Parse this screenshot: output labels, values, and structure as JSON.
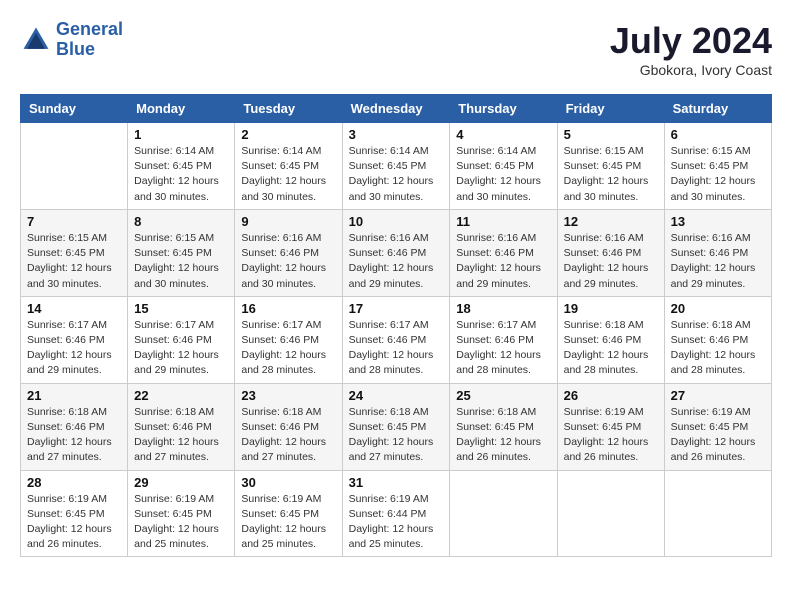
{
  "header": {
    "logo_line1": "General",
    "logo_line2": "Blue",
    "main_title": "July 2024",
    "subtitle": "Gbokora, Ivory Coast"
  },
  "days_header": [
    "Sunday",
    "Monday",
    "Tuesday",
    "Wednesday",
    "Thursday",
    "Friday",
    "Saturday"
  ],
  "weeks": [
    [
      {
        "num": "",
        "info": ""
      },
      {
        "num": "1",
        "info": "Sunrise: 6:14 AM\nSunset: 6:45 PM\nDaylight: 12 hours\nand 30 minutes."
      },
      {
        "num": "2",
        "info": "Sunrise: 6:14 AM\nSunset: 6:45 PM\nDaylight: 12 hours\nand 30 minutes."
      },
      {
        "num": "3",
        "info": "Sunrise: 6:14 AM\nSunset: 6:45 PM\nDaylight: 12 hours\nand 30 minutes."
      },
      {
        "num": "4",
        "info": "Sunrise: 6:14 AM\nSunset: 6:45 PM\nDaylight: 12 hours\nand 30 minutes."
      },
      {
        "num": "5",
        "info": "Sunrise: 6:15 AM\nSunset: 6:45 PM\nDaylight: 12 hours\nand 30 minutes."
      },
      {
        "num": "6",
        "info": "Sunrise: 6:15 AM\nSunset: 6:45 PM\nDaylight: 12 hours\nand 30 minutes."
      }
    ],
    [
      {
        "num": "7",
        "info": ""
      },
      {
        "num": "8",
        "info": "Sunrise: 6:15 AM\nSunset: 6:45 PM\nDaylight: 12 hours\nand 30 minutes."
      },
      {
        "num": "9",
        "info": "Sunrise: 6:16 AM\nSunset: 6:46 PM\nDaylight: 12 hours\nand 30 minutes."
      },
      {
        "num": "10",
        "info": "Sunrise: 6:16 AM\nSunset: 6:46 PM\nDaylight: 12 hours\nand 29 minutes."
      },
      {
        "num": "11",
        "info": "Sunrise: 6:16 AM\nSunset: 6:46 PM\nDaylight: 12 hours\nand 29 minutes."
      },
      {
        "num": "12",
        "info": "Sunrise: 6:16 AM\nSunset: 6:46 PM\nDaylight: 12 hours\nand 29 minutes."
      },
      {
        "num": "13",
        "info": "Sunrise: 6:16 AM\nSunset: 6:46 PM\nDaylight: 12 hours\nand 29 minutes."
      }
    ],
    [
      {
        "num": "14",
        "info": ""
      },
      {
        "num": "15",
        "info": "Sunrise: 6:17 AM\nSunset: 6:46 PM\nDaylight: 12 hours\nand 29 minutes."
      },
      {
        "num": "16",
        "info": "Sunrise: 6:17 AM\nSunset: 6:46 PM\nDaylight: 12 hours\nand 28 minutes."
      },
      {
        "num": "17",
        "info": "Sunrise: 6:17 AM\nSunset: 6:46 PM\nDaylight: 12 hours\nand 28 minutes."
      },
      {
        "num": "18",
        "info": "Sunrise: 6:17 AM\nSunset: 6:46 PM\nDaylight: 12 hours\nand 28 minutes."
      },
      {
        "num": "19",
        "info": "Sunrise: 6:18 AM\nSunset: 6:46 PM\nDaylight: 12 hours\nand 28 minutes."
      },
      {
        "num": "20",
        "info": "Sunrise: 6:18 AM\nSunset: 6:46 PM\nDaylight: 12 hours\nand 28 minutes."
      }
    ],
    [
      {
        "num": "21",
        "info": ""
      },
      {
        "num": "22",
        "info": "Sunrise: 6:18 AM\nSunset: 6:46 PM\nDaylight: 12 hours\nand 27 minutes."
      },
      {
        "num": "23",
        "info": "Sunrise: 6:18 AM\nSunset: 6:46 PM\nDaylight: 12 hours\nand 27 minutes."
      },
      {
        "num": "24",
        "info": "Sunrise: 6:18 AM\nSunset: 6:45 PM\nDaylight: 12 hours\nand 27 minutes."
      },
      {
        "num": "25",
        "info": "Sunrise: 6:18 AM\nSunset: 6:45 PM\nDaylight: 12 hours\nand 26 minutes."
      },
      {
        "num": "26",
        "info": "Sunrise: 6:19 AM\nSunset: 6:45 PM\nDaylight: 12 hours\nand 26 minutes."
      },
      {
        "num": "27",
        "info": "Sunrise: 6:19 AM\nSunset: 6:45 PM\nDaylight: 12 hours\nand 26 minutes."
      }
    ],
    [
      {
        "num": "28",
        "info": "Sunrise: 6:19 AM\nSunset: 6:45 PM\nDaylight: 12 hours\nand 26 minutes."
      },
      {
        "num": "29",
        "info": "Sunrise: 6:19 AM\nSunset: 6:45 PM\nDaylight: 12 hours\nand 25 minutes."
      },
      {
        "num": "30",
        "info": "Sunrise: 6:19 AM\nSunset: 6:45 PM\nDaylight: 12 hours\nand 25 minutes."
      },
      {
        "num": "31",
        "info": "Sunrise: 6:19 AM\nSunset: 6:44 PM\nDaylight: 12 hours\nand 25 minutes."
      },
      {
        "num": "",
        "info": ""
      },
      {
        "num": "",
        "info": ""
      },
      {
        "num": "",
        "info": ""
      }
    ]
  ],
  "week_7_sunday_info": "Sunrise: 6:15 AM\nSunset: 6:45 PM\nDaylight: 12 hours\nand 30 minutes.",
  "week_14_sunday_info": "Sunrise: 6:17 AM\nSunset: 6:46 PM\nDaylight: 12 hours\nand 29 minutes.",
  "week_21_sunday_info": "Sunrise: 6:18 AM\nSunset: 6:46 PM\nDaylight: 12 hours\nand 27 minutes."
}
